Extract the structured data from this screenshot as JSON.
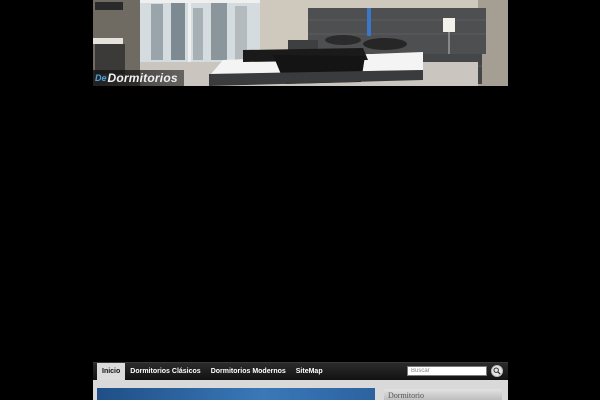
{
  "header": {
    "logo_prefix": "De",
    "logo_text": "Dormitorios"
  },
  "nav": {
    "items": [
      {
        "label": "Inicio",
        "active": true
      },
      {
        "label": "Dormitorios Clásicos",
        "active": false
      },
      {
        "label": "Dormitorios Modernos",
        "active": false
      },
      {
        "label": "SiteMap",
        "active": false
      }
    ],
    "search_placeholder": "Buscar",
    "search_icon": "magnifier-icon"
  },
  "sidebar": {
    "widget_label": "Dormitorio"
  },
  "colors": {
    "page_background": "#000000",
    "nav_background": "#1c1c1c",
    "nav_active": "#dcdcdc",
    "logo_accent": "#4aa3df",
    "content_blue": "#2c62a0"
  }
}
